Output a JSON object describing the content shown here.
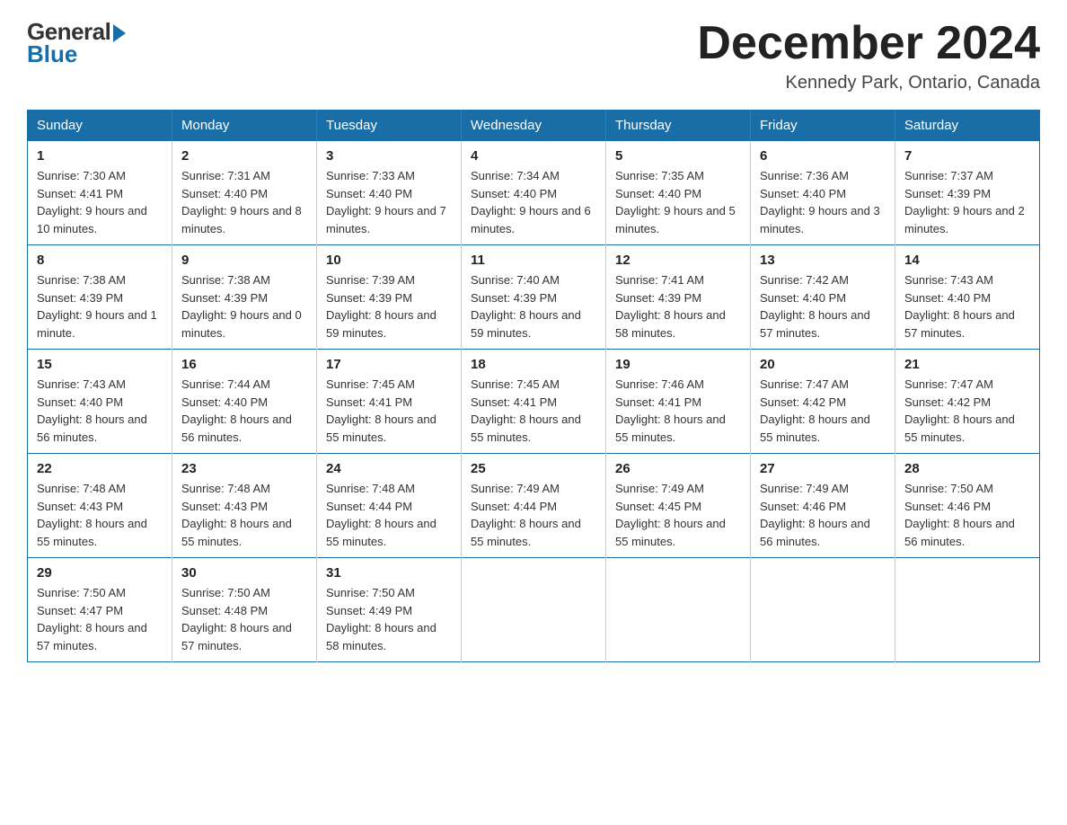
{
  "logo": {
    "general": "General",
    "blue": "Blue"
  },
  "title": "December 2024",
  "location": "Kennedy Park, Ontario, Canada",
  "days_of_week": [
    "Sunday",
    "Monday",
    "Tuesday",
    "Wednesday",
    "Thursday",
    "Friday",
    "Saturday"
  ],
  "weeks": [
    [
      {
        "day": "1",
        "sunrise": "7:30 AM",
        "sunset": "4:41 PM",
        "daylight": "9 hours and 10 minutes."
      },
      {
        "day": "2",
        "sunrise": "7:31 AM",
        "sunset": "4:40 PM",
        "daylight": "9 hours and 8 minutes."
      },
      {
        "day": "3",
        "sunrise": "7:33 AM",
        "sunset": "4:40 PM",
        "daylight": "9 hours and 7 minutes."
      },
      {
        "day": "4",
        "sunrise": "7:34 AM",
        "sunset": "4:40 PM",
        "daylight": "9 hours and 6 minutes."
      },
      {
        "day": "5",
        "sunrise": "7:35 AM",
        "sunset": "4:40 PM",
        "daylight": "9 hours and 5 minutes."
      },
      {
        "day": "6",
        "sunrise": "7:36 AM",
        "sunset": "4:40 PM",
        "daylight": "9 hours and 3 minutes."
      },
      {
        "day": "7",
        "sunrise": "7:37 AM",
        "sunset": "4:39 PM",
        "daylight": "9 hours and 2 minutes."
      }
    ],
    [
      {
        "day": "8",
        "sunrise": "7:38 AM",
        "sunset": "4:39 PM",
        "daylight": "9 hours and 1 minute."
      },
      {
        "day": "9",
        "sunrise": "7:38 AM",
        "sunset": "4:39 PM",
        "daylight": "9 hours and 0 minutes."
      },
      {
        "day": "10",
        "sunrise": "7:39 AM",
        "sunset": "4:39 PM",
        "daylight": "8 hours and 59 minutes."
      },
      {
        "day": "11",
        "sunrise": "7:40 AM",
        "sunset": "4:39 PM",
        "daylight": "8 hours and 59 minutes."
      },
      {
        "day": "12",
        "sunrise": "7:41 AM",
        "sunset": "4:39 PM",
        "daylight": "8 hours and 58 minutes."
      },
      {
        "day": "13",
        "sunrise": "7:42 AM",
        "sunset": "4:40 PM",
        "daylight": "8 hours and 57 minutes."
      },
      {
        "day": "14",
        "sunrise": "7:43 AM",
        "sunset": "4:40 PM",
        "daylight": "8 hours and 57 minutes."
      }
    ],
    [
      {
        "day": "15",
        "sunrise": "7:43 AM",
        "sunset": "4:40 PM",
        "daylight": "8 hours and 56 minutes."
      },
      {
        "day": "16",
        "sunrise": "7:44 AM",
        "sunset": "4:40 PM",
        "daylight": "8 hours and 56 minutes."
      },
      {
        "day": "17",
        "sunrise": "7:45 AM",
        "sunset": "4:41 PM",
        "daylight": "8 hours and 55 minutes."
      },
      {
        "day": "18",
        "sunrise": "7:45 AM",
        "sunset": "4:41 PM",
        "daylight": "8 hours and 55 minutes."
      },
      {
        "day": "19",
        "sunrise": "7:46 AM",
        "sunset": "4:41 PM",
        "daylight": "8 hours and 55 minutes."
      },
      {
        "day": "20",
        "sunrise": "7:47 AM",
        "sunset": "4:42 PM",
        "daylight": "8 hours and 55 minutes."
      },
      {
        "day": "21",
        "sunrise": "7:47 AM",
        "sunset": "4:42 PM",
        "daylight": "8 hours and 55 minutes."
      }
    ],
    [
      {
        "day": "22",
        "sunrise": "7:48 AM",
        "sunset": "4:43 PM",
        "daylight": "8 hours and 55 minutes."
      },
      {
        "day": "23",
        "sunrise": "7:48 AM",
        "sunset": "4:43 PM",
        "daylight": "8 hours and 55 minutes."
      },
      {
        "day": "24",
        "sunrise": "7:48 AM",
        "sunset": "4:44 PM",
        "daylight": "8 hours and 55 minutes."
      },
      {
        "day": "25",
        "sunrise": "7:49 AM",
        "sunset": "4:44 PM",
        "daylight": "8 hours and 55 minutes."
      },
      {
        "day": "26",
        "sunrise": "7:49 AM",
        "sunset": "4:45 PM",
        "daylight": "8 hours and 55 minutes."
      },
      {
        "day": "27",
        "sunrise": "7:49 AM",
        "sunset": "4:46 PM",
        "daylight": "8 hours and 56 minutes."
      },
      {
        "day": "28",
        "sunrise": "7:50 AM",
        "sunset": "4:46 PM",
        "daylight": "8 hours and 56 minutes."
      }
    ],
    [
      {
        "day": "29",
        "sunrise": "7:50 AM",
        "sunset": "4:47 PM",
        "daylight": "8 hours and 57 minutes."
      },
      {
        "day": "30",
        "sunrise": "7:50 AM",
        "sunset": "4:48 PM",
        "daylight": "8 hours and 57 minutes."
      },
      {
        "day": "31",
        "sunrise": "7:50 AM",
        "sunset": "4:49 PM",
        "daylight": "8 hours and 58 minutes."
      },
      null,
      null,
      null,
      null
    ]
  ],
  "labels": {
    "sunrise": "Sunrise:",
    "sunset": "Sunset:",
    "daylight": "Daylight:"
  }
}
